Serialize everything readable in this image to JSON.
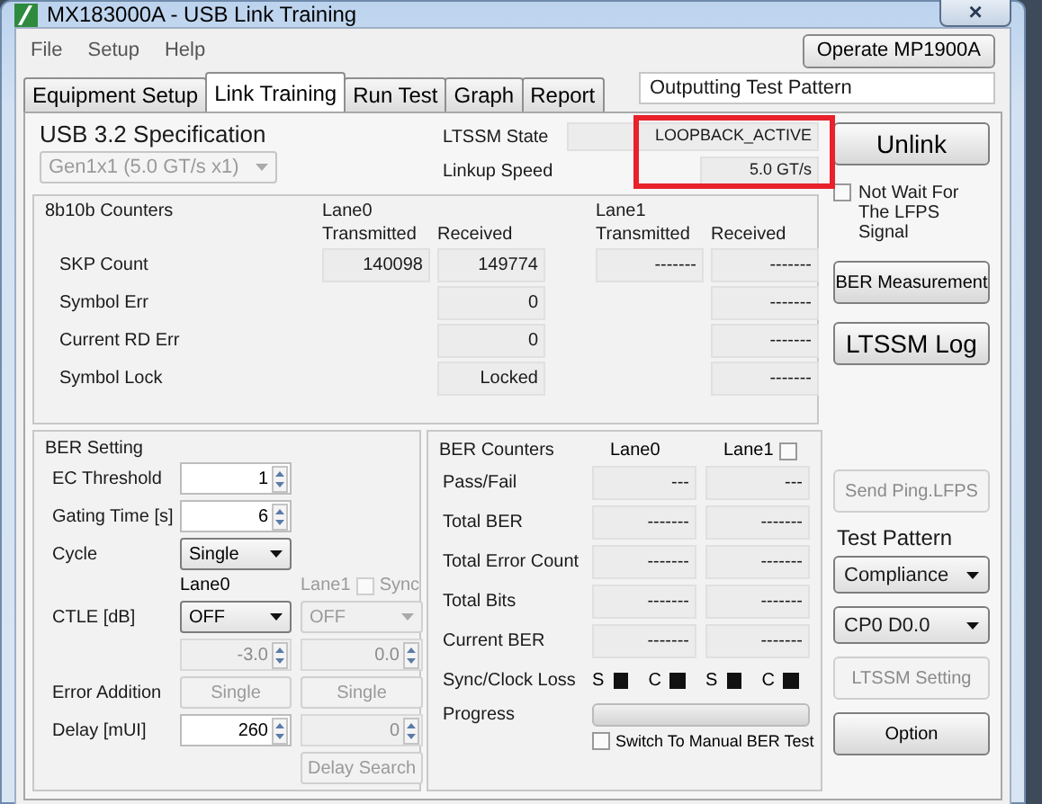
{
  "window": {
    "title": "MX183000A - USB Link Training",
    "close": "×"
  },
  "menu": [
    "File",
    "Setup",
    "Help"
  ],
  "operate_button": "Operate MP1900A",
  "tabs": [
    {
      "label": "Equipment Setup",
      "selected": false
    },
    {
      "label": "Link Training",
      "selected": true
    },
    {
      "label": "Run Test",
      "selected": false
    },
    {
      "label": "Graph",
      "selected": false
    },
    {
      "label": "Report",
      "selected": false
    }
  ],
  "status_field": "Outputting Test Pattern",
  "spec": {
    "label": "USB 3.2 Specification",
    "value": "Gen1x1 (5.0 GT/s x1)",
    "disabled": true
  },
  "link": [
    {
      "label": "LTSSM State",
      "value": "LOOPBACK_ACTIVE",
      "wide": true
    },
    {
      "label": "Linkup Speed",
      "value": "5.0 GT/s",
      "wide": false
    }
  ],
  "link_highlight": true,
  "counters": {
    "title": "8b10b Counters",
    "lanes": [
      "Lane0",
      "Lane1"
    ],
    "columns": [
      "Transmitted",
      "Received",
      "Transmitted",
      "Received"
    ],
    "rows": [
      {
        "label": "SKP Count",
        "cells": [
          "140098",
          "149774",
          "-------",
          "-------"
        ]
      },
      {
        "label": "Symbol Err",
        "cells": [
          null,
          "0",
          null,
          "-------"
        ]
      },
      {
        "label": "Current RD Err",
        "cells": [
          null,
          "0",
          null,
          "-------"
        ]
      },
      {
        "label": "Symbol Lock",
        "cells": [
          null,
          "Locked",
          null,
          "-------"
        ]
      }
    ]
  },
  "ber_setting": {
    "title": "BER Setting",
    "rows": [
      {
        "label": "EC Threshold",
        "cells": [
          {
            "kind": "spin",
            "value": "1",
            "disabled": false
          },
          null
        ]
      },
      {
        "label": "Gating Time [s]",
        "cells": [
          {
            "kind": "spin",
            "value": "6",
            "disabled": false
          },
          null
        ]
      },
      {
        "label": "Cycle",
        "cells": [
          {
            "kind": "select",
            "value": "Single",
            "disabled": false
          },
          null
        ]
      },
      {
        "cells": [
          {
            "kind": "caption",
            "value": "Lane0",
            "disabled": false
          },
          {
            "kind": "caption-check",
            "value": "Lane1",
            "disabled": true,
            "check": "Sync",
            "checked": false
          }
        ]
      },
      {
        "label": "CTLE [dB]",
        "cells": [
          {
            "kind": "select",
            "value": "OFF",
            "disabled": false
          },
          {
            "kind": "select",
            "value": "OFF",
            "disabled": true
          }
        ]
      },
      {
        "cells": [
          {
            "kind": "spin",
            "value": "-3.0",
            "disabled": true
          },
          {
            "kind": "spin",
            "value": "0.0",
            "disabled": true
          }
        ]
      },
      {
        "label": "Error Addition",
        "cells": [
          {
            "kind": "button",
            "value": "Single",
            "disabled": true
          },
          {
            "kind": "button",
            "value": "Single",
            "disabled": true
          }
        ]
      },
      {
        "label": "Delay [mUI]",
        "cells": [
          {
            "kind": "spin",
            "value": "260",
            "disabled": false
          },
          {
            "kind": "spin",
            "value": "0",
            "disabled": true
          }
        ]
      },
      {
        "cells": [
          null,
          {
            "kind": "button",
            "value": "Delay Search",
            "disabled": true
          }
        ]
      }
    ]
  },
  "ber_counters": {
    "title": "BER Counters",
    "lanes": [
      {
        "label": "Lane0"
      },
      {
        "label": "Lane1",
        "checked": false
      }
    ],
    "rows": [
      {
        "label": "Pass/Fail",
        "cells": [
          "---",
          "---"
        ]
      },
      {
        "label": "Total BER",
        "cells": [
          "-------",
          "-------"
        ]
      },
      {
        "label": "Total Error Count",
        "cells": [
          "-------",
          "-------"
        ]
      },
      {
        "label": "Total Bits",
        "cells": [
          "-------",
          "-------"
        ]
      },
      {
        "label": "Current BER",
        "cells": [
          "-------",
          "-------"
        ]
      }
    ],
    "loss": {
      "label": "Sync/Clock Loss",
      "lanes": [
        [
          {
            "label": "S",
            "lost": false
          },
          {
            "label": "C",
            "lost": false
          }
        ],
        [
          {
            "label": "S",
            "lost": false
          },
          {
            "label": "C",
            "lost": false
          }
        ]
      ]
    },
    "progress": {
      "label": "Progress",
      "level": 0
    },
    "manual": {
      "label": "Switch To Manual BER Test",
      "checked": false
    }
  },
  "right_top": [
    {
      "kind": "button",
      "label": "Unlink",
      "disabled": false,
      "large": true
    },
    {
      "kind": "check",
      "label": "Not Wait For The LFPS Signal",
      "checked": false
    },
    {
      "kind": "button",
      "label": "BER Measurement",
      "disabled": false,
      "large": false
    },
    {
      "kind": "button",
      "label": "LTSSM Log",
      "disabled": false,
      "large": true
    }
  ],
  "right_bottom": [
    {
      "kind": "button",
      "label": "Send Ping.LFPS",
      "disabled": true,
      "large": false
    },
    {
      "kind": "label",
      "label": "Test Pattern"
    },
    {
      "kind": "select",
      "label": "Compliance"
    },
    {
      "kind": "select",
      "label": "CP0 D0.0"
    },
    {
      "kind": "button",
      "label": "LTSSM Setting",
      "disabled": true,
      "large": false
    },
    {
      "kind": "button",
      "label": "Option",
      "disabled": false,
      "large": false
    }
  ]
}
